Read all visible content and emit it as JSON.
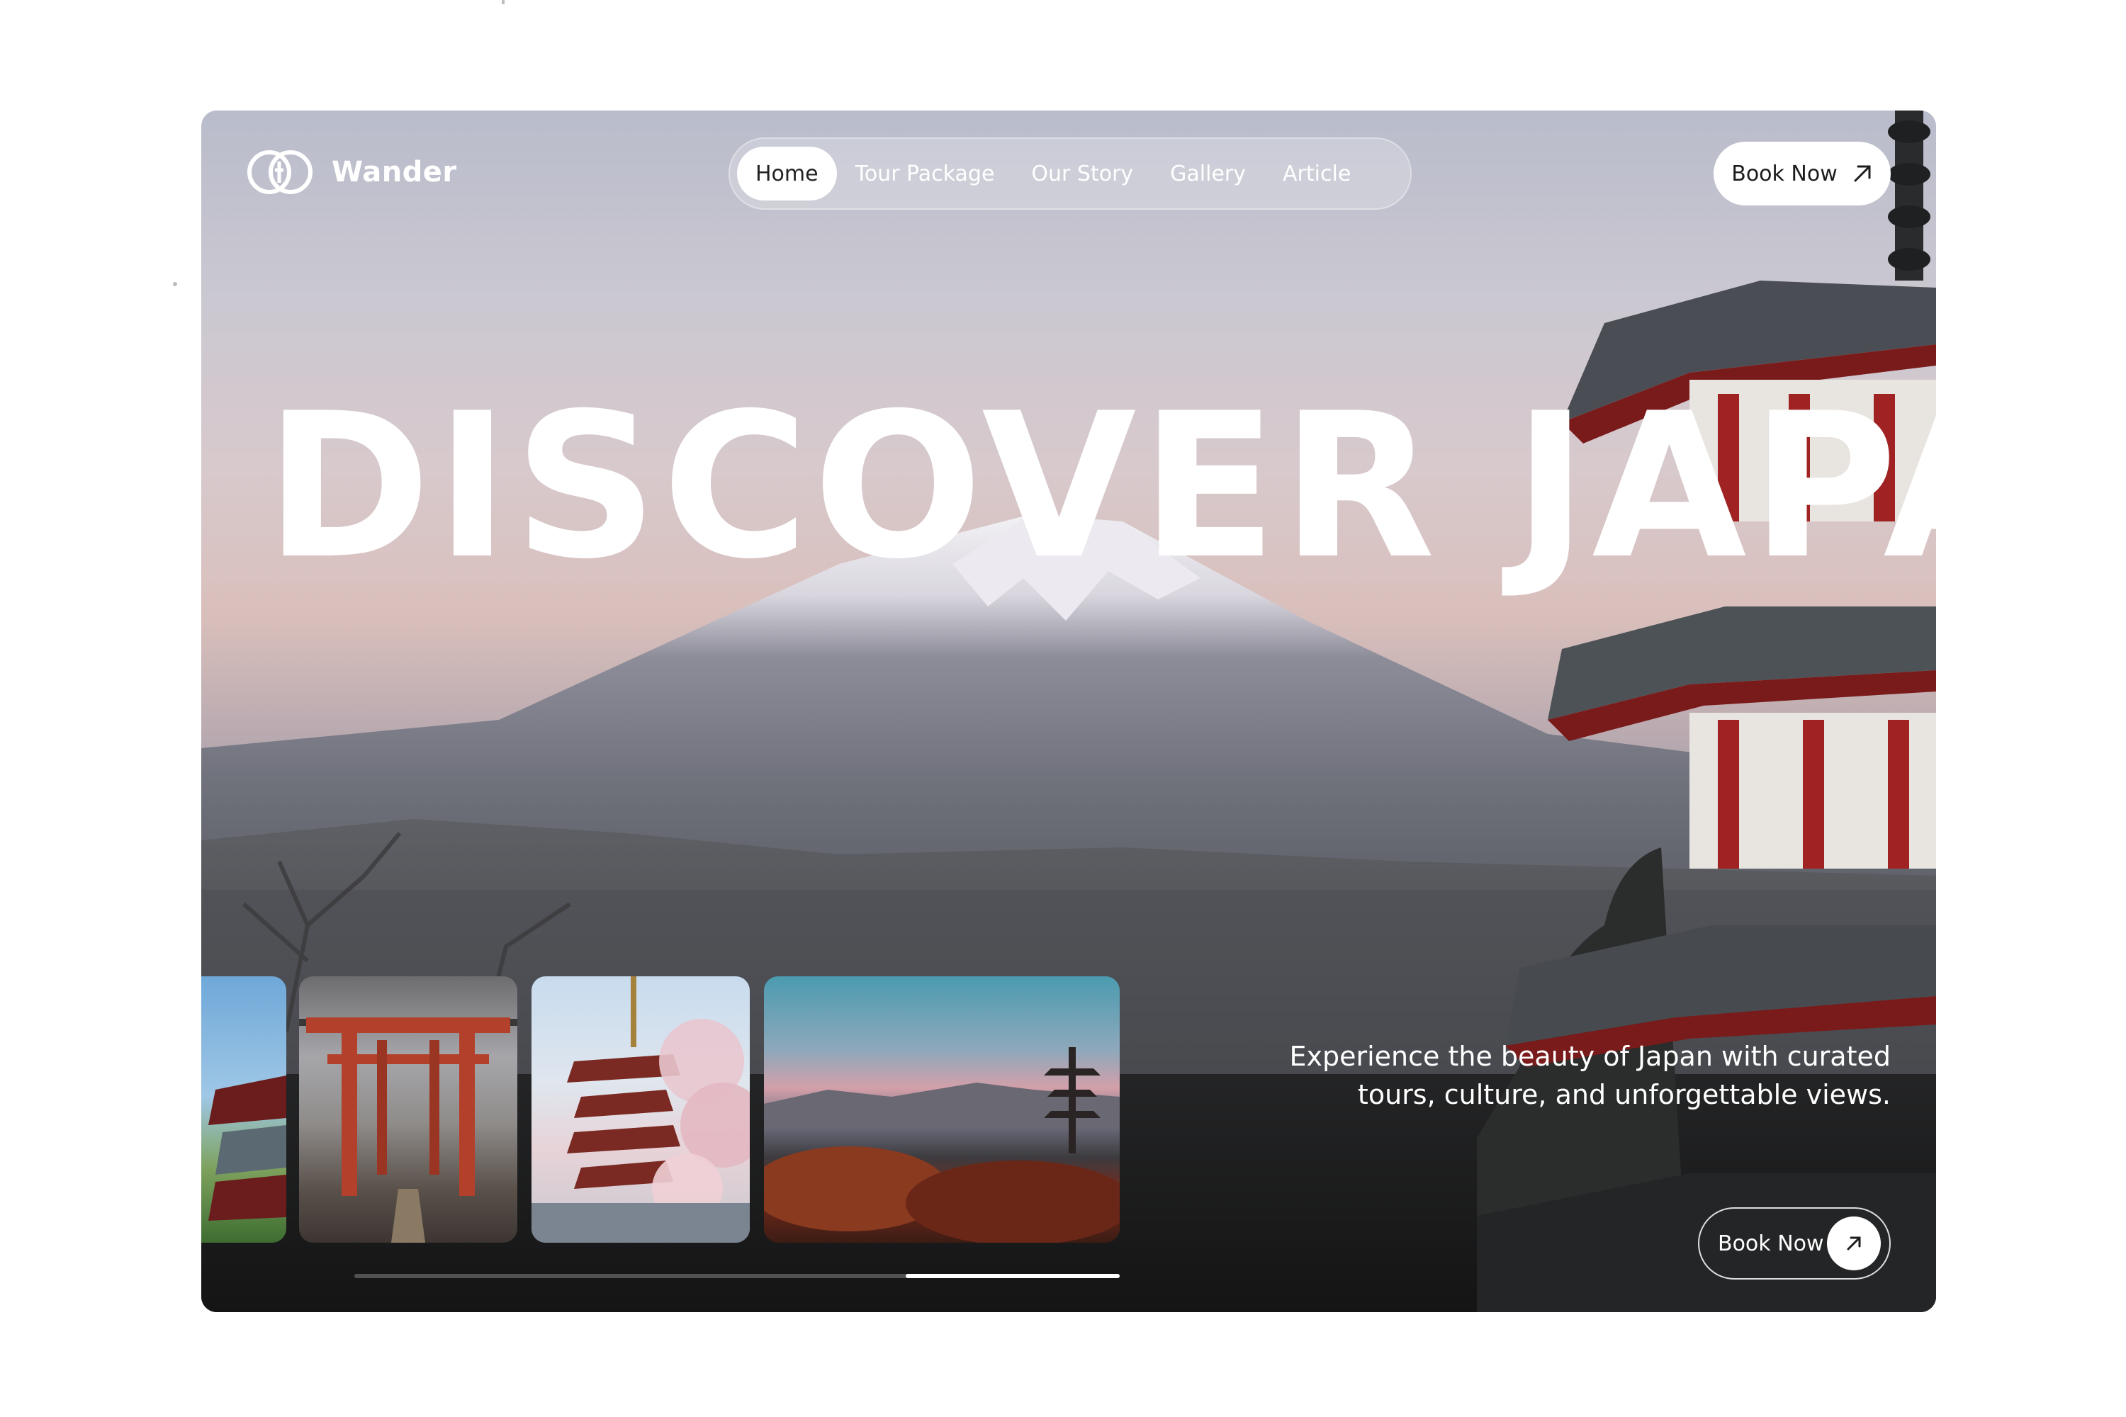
{
  "brand": {
    "name": "Wander",
    "logo_icon": "wander-logo-icon"
  },
  "nav": {
    "items": [
      {
        "label": "Home",
        "active": true
      },
      {
        "label": "Tour Package",
        "active": false
      },
      {
        "label": "Our Story",
        "active": false
      },
      {
        "label": "Gallery",
        "active": false
      },
      {
        "label": "Article",
        "active": false
      }
    ]
  },
  "header": {
    "book_label": "Book Now",
    "book_icon": "arrow-up-right-icon"
  },
  "hero": {
    "headline": "DISCOVER JAPAN",
    "tagline_line1": "Experience the beauty of Japan with curated",
    "tagline_line2": "tours, culture, and unforgettable views.",
    "book_label": "Book Now",
    "book_icon": "arrow-up-right-icon"
  },
  "gallery": {
    "thumbnails": [
      {
        "subject": "pagoda-partial"
      },
      {
        "subject": "torii-gate-in-water"
      },
      {
        "subject": "pagoda-with-cherry-blossoms"
      },
      {
        "subject": "pagoda-landscape-sunset"
      }
    ],
    "progress": 0.28
  },
  "colors": {
    "accent": "#ffffff",
    "text_dark": "#1c1c1c"
  }
}
